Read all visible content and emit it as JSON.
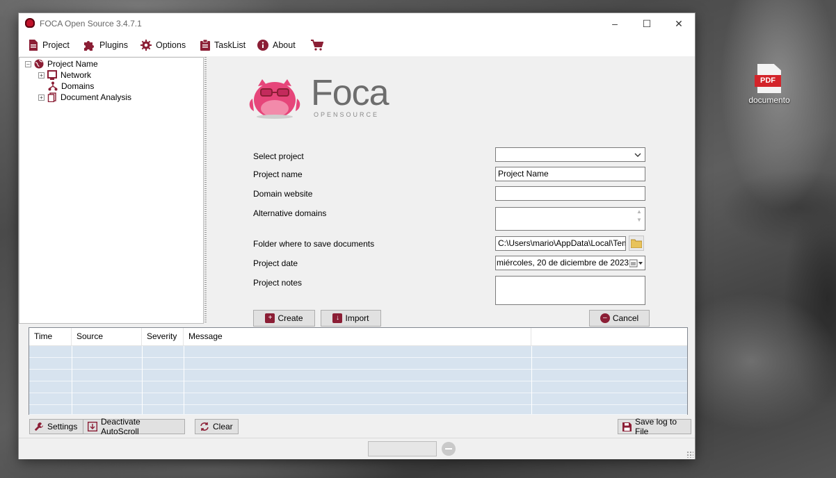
{
  "window": {
    "title": "FOCA Open Source 3.4.7.1"
  },
  "menu": [
    {
      "label": "Project",
      "icon": "document-icon"
    },
    {
      "label": "Plugins",
      "icon": "puzzle-icon"
    },
    {
      "label": "Options",
      "icon": "gear-icon"
    },
    {
      "label": "TaskList",
      "icon": "clipboard-icon"
    },
    {
      "label": "About",
      "icon": "info-icon"
    },
    {
      "label": "",
      "icon": "cart-icon"
    }
  ],
  "tree": {
    "root": "Project Name",
    "children": [
      "Network",
      "Domains",
      "Document Analysis"
    ]
  },
  "logo": {
    "word": "Foca",
    "sub": "OPENSOURCE"
  },
  "form": {
    "select_project_label": "Select project",
    "select_project_value": "",
    "project_name_label": "Project name",
    "project_name_value": "Project Name",
    "domain_website_label": "Domain website",
    "domain_website_value": "",
    "alt_domains_label": "Alternative domains",
    "alt_domains_value": "",
    "folder_label": "Folder where to save documents",
    "folder_value": "C:\\Users\\mario\\AppData\\Local\\Temp",
    "date_label": "Project date",
    "date_value": "miércoles, 20 de  diciembre  de 2023",
    "notes_label": "Project notes",
    "notes_value": "",
    "create_label": "Create",
    "import_label": "Import",
    "cancel_label": "Cancel"
  },
  "log": {
    "columns": [
      "Time",
      "Source",
      "Severity",
      "Message",
      ""
    ]
  },
  "bottom": {
    "settings_label": "Settings",
    "autoscroll_label": "Deactivate AutoScroll",
    "clear_label": "Clear",
    "save_label": "Save log to File"
  },
  "desktop": {
    "icon_label": "documento",
    "icon_tag": "PDF"
  },
  "colors": {
    "accent": "#8b1e35",
    "log_row": "#d7e3ef"
  }
}
